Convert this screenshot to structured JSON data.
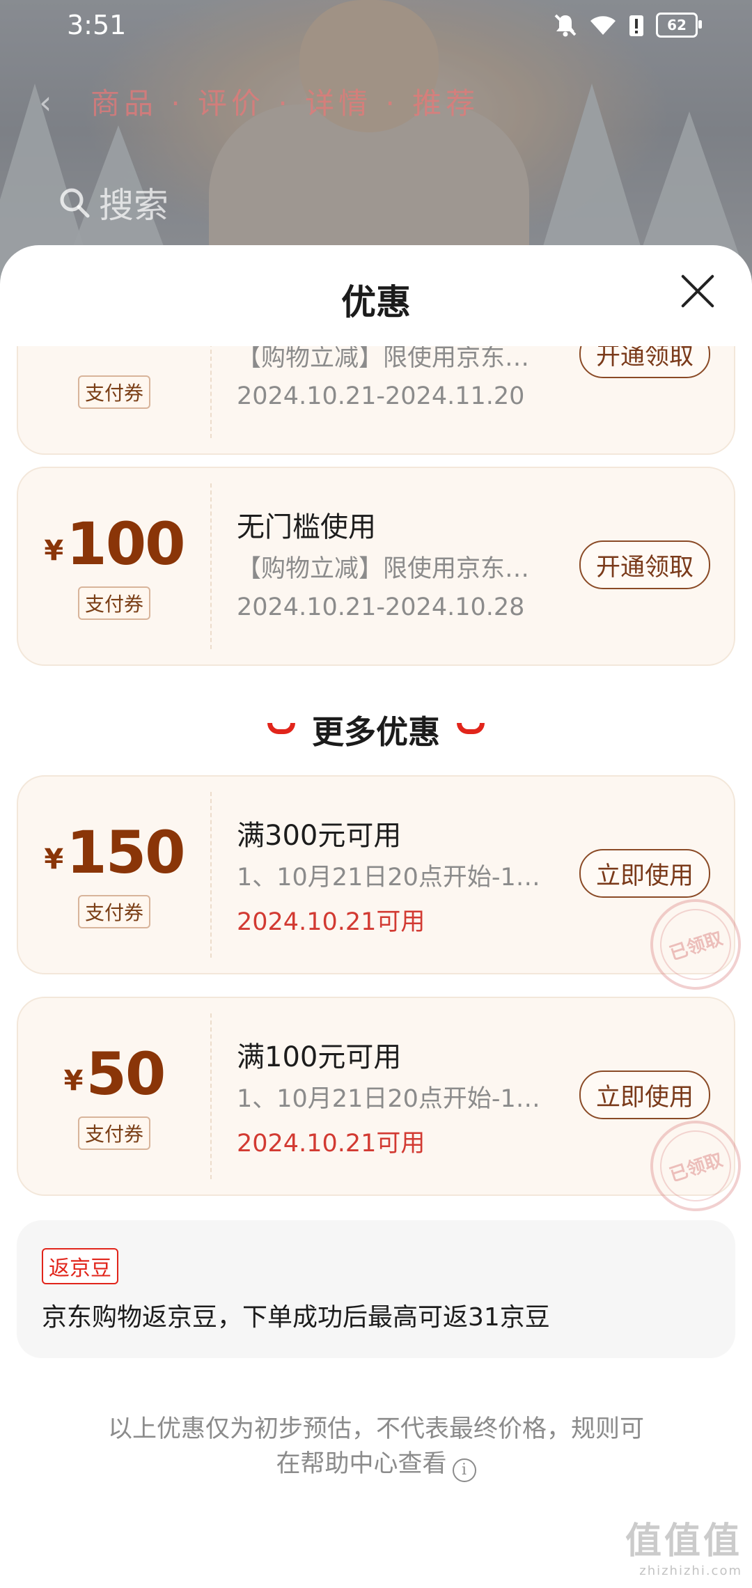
{
  "status_bar": {
    "time": "3:51",
    "battery": "62"
  },
  "background": {
    "title_text": "商品 · 评价 · 详情 · 推荐",
    "search_text": "搜索"
  },
  "sheet": {
    "title": "优惠"
  },
  "coupons_top": [
    {
      "currency": "",
      "amount": "",
      "tag": "支付券",
      "line1": "",
      "line2": "【购物立减】限使用京东…",
      "line3": "2024.10.21-2024.11.20",
      "action": "开通领取"
    },
    {
      "currency": "¥",
      "amount": "100",
      "tag": "支付券",
      "line1": "无门槛使用",
      "line2": "【购物立减】限使用京东…",
      "line3": "2024.10.21-2024.10.28",
      "action": "开通领取"
    }
  ],
  "more_section": {
    "title": "更多优惠"
  },
  "coupons_more": [
    {
      "currency": "¥",
      "amount": "150",
      "tag": "支付券",
      "line1": "满300元可用",
      "line2": "1、10月21日20点开始-1…",
      "line3": "2024.10.21可用",
      "action": "立即使用",
      "stamp": "已领取"
    },
    {
      "currency": "¥",
      "amount": "50",
      "tag": "支付券",
      "line1": "满100元可用",
      "line2": "1、10月21日20点开始-1…",
      "line3": "2024.10.21可用",
      "action": "立即使用",
      "stamp": "已领取"
    }
  ],
  "jd_bean": {
    "badge": "返京豆",
    "text": "京东购物返京豆，下单成功后最高可返31京豆"
  },
  "footnote": {
    "line1": "以上优惠仅为初步预估，不代表最终价格，规则可",
    "line2": "在帮助中心查看"
  },
  "watermark": {
    "big": "值值值",
    "small": "zhizhizhi.com"
  },
  "colors": {
    "accent_red": "#e1251b",
    "coupon_brown": "#8a3508",
    "card_bg": "#fdf7f1"
  },
  "icons": [
    "mute-icon",
    "wifi-icon",
    "alert-icon",
    "battery-icon",
    "close-icon",
    "info-icon",
    "search-icon",
    "back-icon"
  ]
}
